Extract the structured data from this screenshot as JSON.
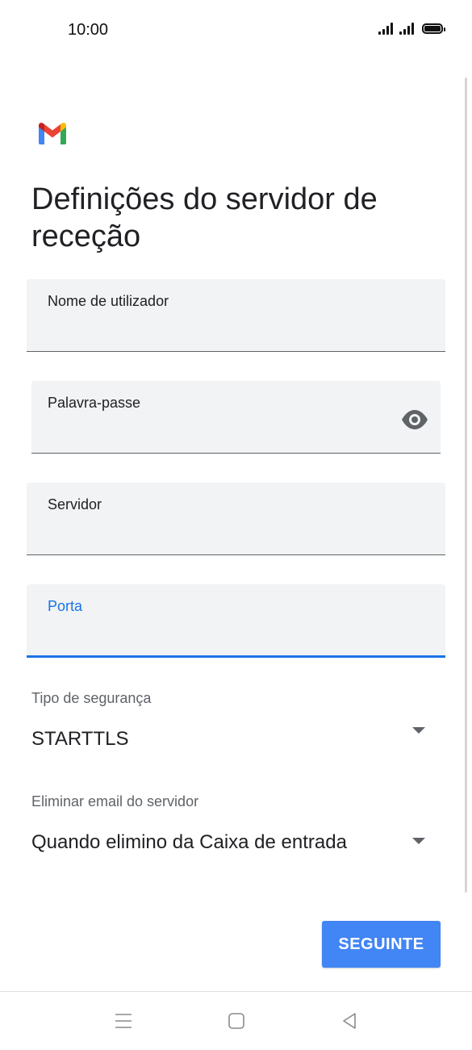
{
  "status_bar": {
    "time": "10:00"
  },
  "app": {
    "logo": "gmail-logo",
    "title": "Definições do servidor de receção"
  },
  "form": {
    "username": {
      "label": "Nome de utilizador",
      "value": ""
    },
    "password": {
      "label": "Palavra-passe",
      "value": "",
      "icon": "eye-icon"
    },
    "server": {
      "label": "Servidor",
      "value": ""
    },
    "port": {
      "label": "Porta",
      "value": ""
    },
    "security": {
      "label": "Tipo de segurança",
      "value": "STARTTLS",
      "icon": "dropdown-arrow-icon"
    },
    "delete_email": {
      "label": "Eliminar email do servidor",
      "value": "Quando elimino da Caixa de entrada",
      "icon": "dropdown-arrow-icon"
    }
  },
  "actions": {
    "next_label": "SEGUINTE"
  },
  "colors": {
    "accent": "#4285f4",
    "focus": "#1a73e8",
    "field_bg": "#f1f3f4"
  },
  "nav_bar": {
    "icons": [
      "menu-icon",
      "home-icon",
      "back-icon"
    ]
  }
}
